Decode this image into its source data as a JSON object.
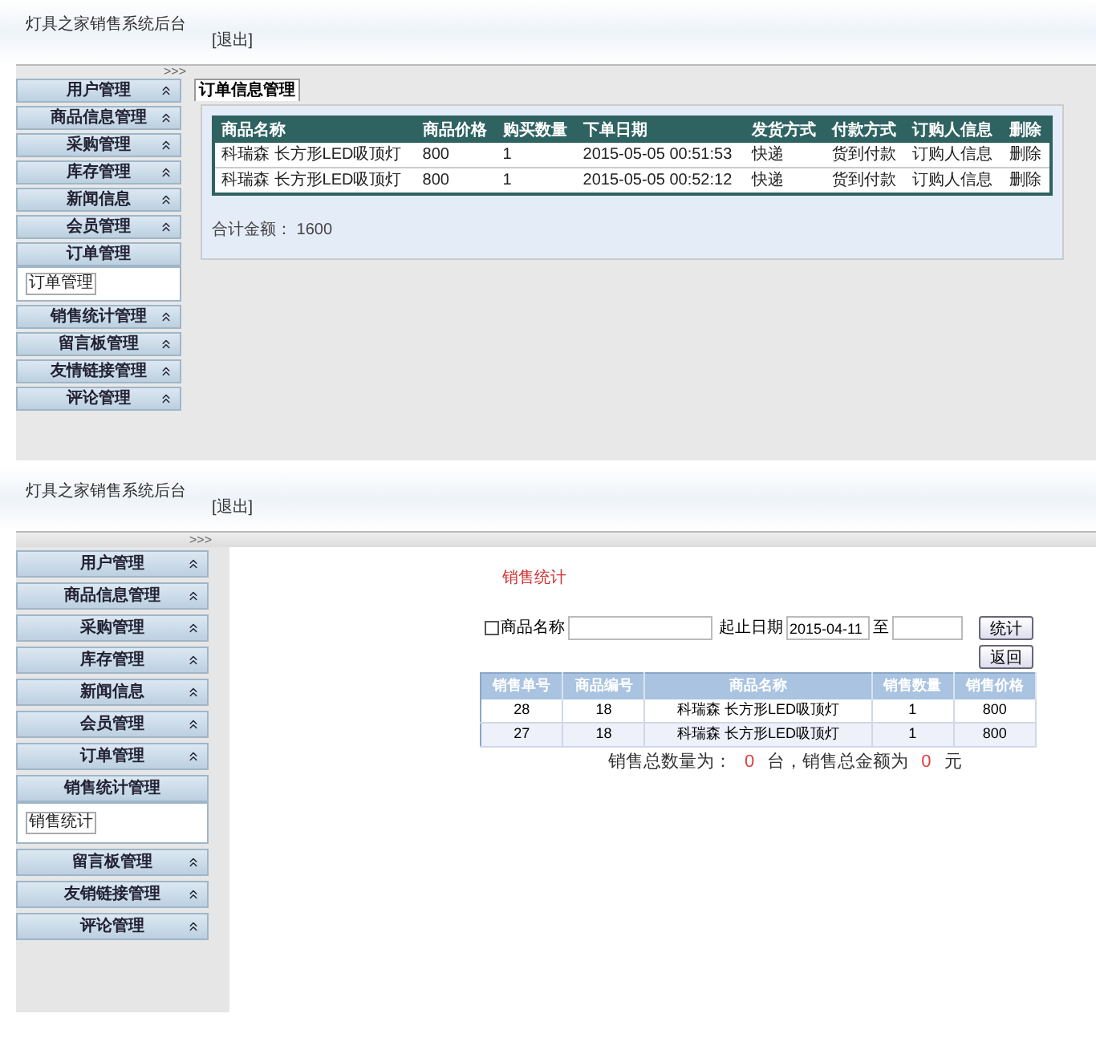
{
  "screens": [
    {
      "kind": "orders",
      "title": "灯具之家销售系统后台",
      "logout": "[退出]",
      "toggle": ">>>",
      "menu": [
        {
          "label": "用户管理",
          "expanded": false
        },
        {
          "label": "商品信息管理",
          "expanded": false
        },
        {
          "label": "采购管理",
          "expanded": false
        },
        {
          "label": "库存管理",
          "expanded": false
        },
        {
          "label": "新闻信息",
          "expanded": false
        },
        {
          "label": "会员管理",
          "expanded": false
        },
        {
          "label": "订单管理",
          "expanded": true,
          "children": [
            "订单管理"
          ]
        },
        {
          "label": "销售统计管理",
          "expanded": false
        },
        {
          "label": "留言板管理",
          "expanded": false
        },
        {
          "label": "友情链接管理",
          "expanded": false
        },
        {
          "label": "评论管理",
          "expanded": false
        }
      ],
      "tabs": [
        {
          "label": "订单信息管理",
          "selected": true
        }
      ],
      "table": {
        "columns": [
          "商品名称",
          "商品价格",
          "购买数量",
          "下单日期",
          "发货方式",
          "付款方式",
          "订购人信息",
          "删除"
        ],
        "rows": [
          [
            "科瑞森 长方形LED吸顶灯",
            "800",
            "1",
            "2015-05-05 00:51:53",
            "快递",
            "货到付款",
            "订购人信息",
            "删除"
          ],
          [
            "科瑞森 长方形LED吸顶灯",
            "800",
            "1",
            "2015-05-05 00:52:12",
            "快递",
            "货到付款",
            "订购人信息",
            "删除"
          ]
        ]
      },
      "total": "合计金额： 1600"
    },
    {
      "kind": "sales",
      "title": "灯具之家销售系统后台",
      "logout": "[退出]",
      "toggle": ">>>",
      "menu": [
        {
          "label": "用户管理",
          "expanded": false
        },
        {
          "label": "商品信息管理",
          "expanded": false
        },
        {
          "label": "采购管理",
          "expanded": false
        },
        {
          "label": "库存管理",
          "expanded": false
        },
        {
          "label": "新闻信息",
          "expanded": false
        },
        {
          "label": "会员管理",
          "expanded": false
        },
        {
          "label": "订单管理",
          "expanded": false
        },
        {
          "label": "销售统计管理",
          "expanded": true,
          "children": [
            "销售统计"
          ]
        },
        {
          "label": "留言板管理",
          "expanded": false
        },
        {
          "label": "友销链接管理",
          "expanded": false
        },
        {
          "label": "评论管理",
          "expanded": false
        }
      ],
      "heading": "销售统计",
      "filter": {
        "name_label": "商品名称",
        "name_checked": false,
        "date_label": "起止日期",
        "start_value": "2015-04-11",
        "to_label": "至",
        "buttons": [
          "统计",
          "返回"
        ]
      },
      "table": {
        "columns": [
          "销售单号",
          "商品编号",
          "商品名称",
          "销售数量",
          "销售价格"
        ],
        "rows": [
          [
            "28",
            "18",
            "科瑞森 长方形LED吸顶灯",
            "1",
            "800"
          ],
          [
            "27",
            "18",
            "科瑞森 长方形LED吸顶灯",
            "1",
            "800"
          ]
        ]
      },
      "summary": [
        {
          "text": "销售总数量为：",
          "highlight": false
        },
        {
          "text": "0",
          "highlight": true
        },
        {
          "text": "台，销售总金额为",
          "highlight": false
        },
        {
          "text": "0",
          "highlight": true
        },
        {
          "text": "元",
          "highlight": false
        }
      ]
    }
  ]
}
